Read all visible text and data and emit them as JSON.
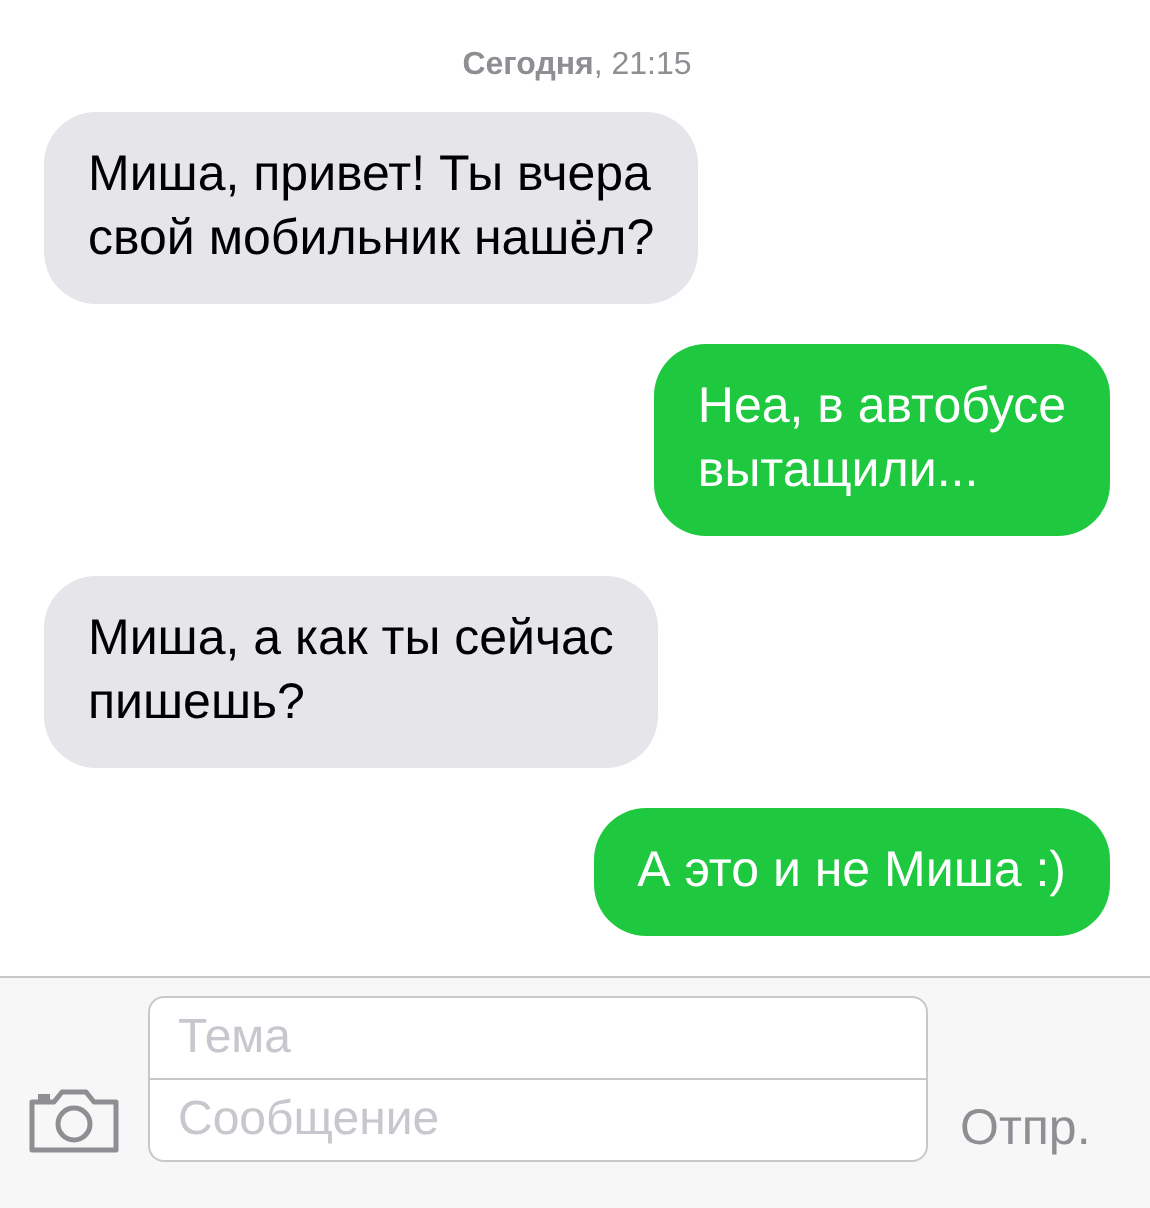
{
  "header": {
    "timestamp": "**Сегодня**, 21:15"
  },
  "messages": [
    {
      "kind": "received",
      "text": "Миша, привет! Ты вчера\nсвой мобильник нашёл?"
    },
    {
      "kind": "sent",
      "text": "Неа, в автобусе\nвытащили..."
    },
    {
      "kind": "received",
      "text": "Миша, а как ты сейчас\nпишешь?"
    },
    {
      "kind": "sent",
      "text": "А это и не Миша :)"
    }
  ],
  "composer": {
    "subject_placeholder": "Тема",
    "message_placeholder": "Сообщение",
    "send_label": "Отпр."
  }
}
